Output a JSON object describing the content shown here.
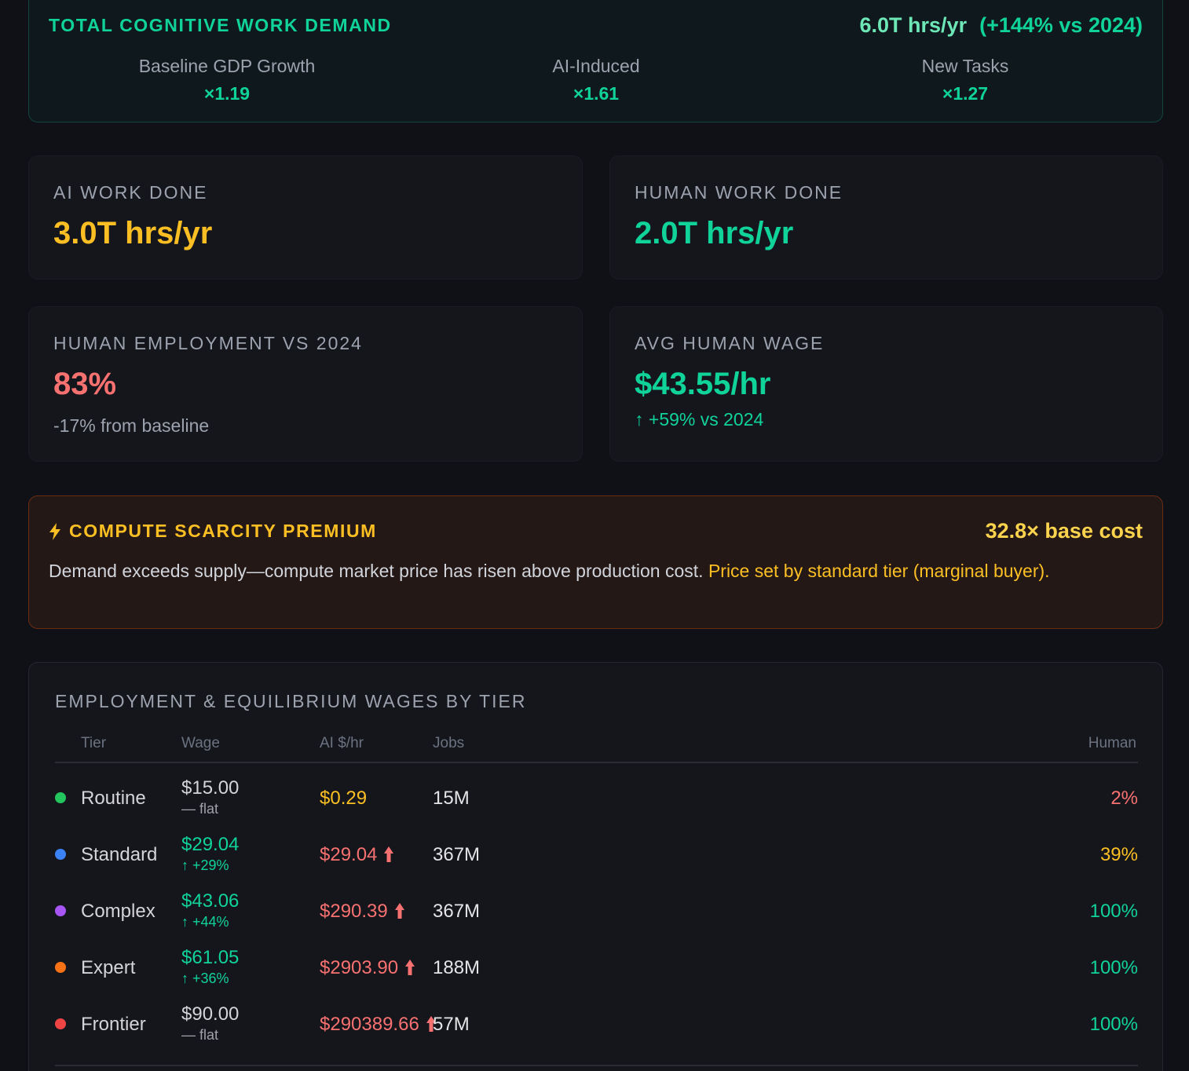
{
  "demand": {
    "title": "TOTAL COGNITIVE WORK DEMAND",
    "total_value": "6.0T hrs/yr",
    "total_change": "(+144% vs 2024)",
    "factors": [
      {
        "label": "Baseline GDP Growth",
        "value": "×1.19"
      },
      {
        "label": "AI-Induced",
        "value": "×1.61"
      },
      {
        "label": "New Tasks",
        "value": "×1.27"
      }
    ]
  },
  "stats": {
    "ai_work": {
      "label": "AI WORK DONE",
      "value": "3.0T hrs/yr"
    },
    "human_work": {
      "label": "HUMAN WORK DONE",
      "value": "2.0T hrs/yr"
    },
    "employment": {
      "label": "HUMAN EMPLOYMENT VS 2024",
      "value": "83%",
      "sub": "-17% from baseline"
    },
    "wage": {
      "label": "AVG HUMAN WAGE",
      "value": "$43.55/hr",
      "sub": "↑ +59% vs 2024"
    }
  },
  "scarcity": {
    "icon": "lightning-icon",
    "title": "COMPUTE SCARCITY PREMIUM",
    "cost": "32.8× base cost",
    "desc": "Demand exceeds supply—compute market price has risen above production cost.",
    "highlight": "Price set by standard tier (marginal buyer)."
  },
  "tiers": {
    "title": "EMPLOYMENT & EQUILIBRIUM WAGES BY TIER",
    "headers": {
      "tier": "Tier",
      "wage": "Wage",
      "ai": "AI $/hr",
      "jobs": "Jobs",
      "human": "Human"
    },
    "rows": [
      {
        "name": "Routine",
        "color": "#22c55e",
        "wage": "$15.00",
        "delta": "— flat",
        "up": false,
        "ai": "$0.29",
        "ai_up": false,
        "jobs": "15M",
        "human": "2%",
        "human_color": "#f87171"
      },
      {
        "name": "Standard",
        "color": "#3b82f6",
        "wage": "$29.04",
        "delta": "↑ +29%",
        "up": true,
        "ai": "$29.04",
        "ai_up": true,
        "jobs": "367M",
        "human": "39%",
        "human_color": "#fbbf24"
      },
      {
        "name": "Complex",
        "color": "#a855f7",
        "wage": "$43.06",
        "delta": "↑ +44%",
        "up": true,
        "ai": "$290.39",
        "ai_up": true,
        "jobs": "367M",
        "human": "100%",
        "human_color": "#10d39a"
      },
      {
        "name": "Expert",
        "color": "#f97316",
        "wage": "$61.05",
        "delta": "↑ +36%",
        "up": true,
        "ai": "$2903.90",
        "ai_up": true,
        "jobs": "188M",
        "human": "100%",
        "human_color": "#10d39a"
      },
      {
        "name": "Frontier",
        "color": "#ef4444",
        "wage": "$90.00",
        "delta": "— flat",
        "up": false,
        "ai": "$290389.66",
        "ai_up": true,
        "jobs": "57M",
        "human": "100%",
        "human_color": "#10d39a"
      }
    ]
  }
}
